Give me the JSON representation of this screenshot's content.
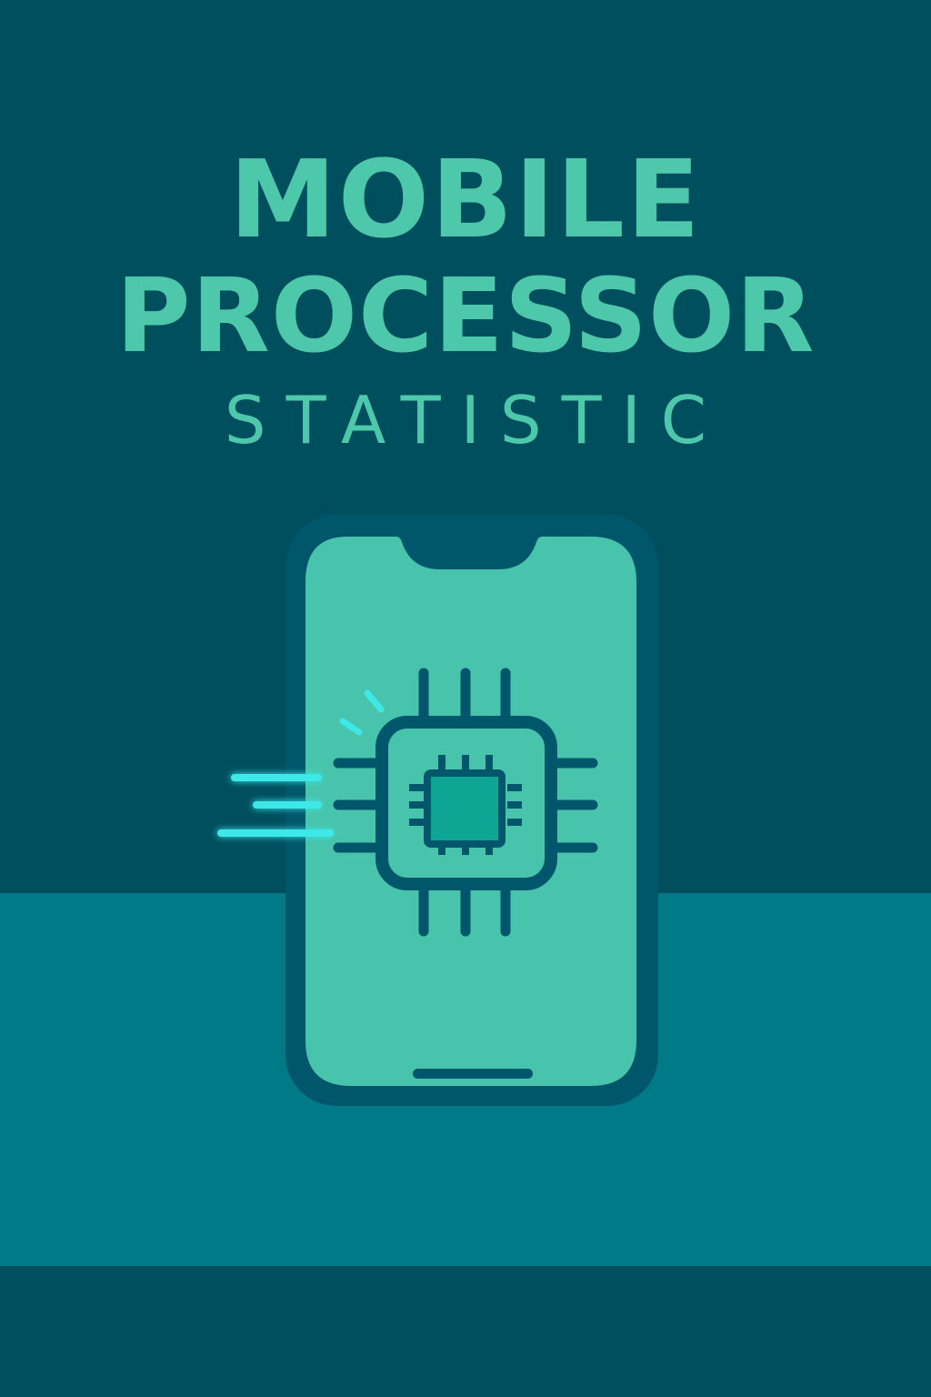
{
  "poster": {
    "title_line_1": "MOBILE",
    "title_line_2": "PROCESSOR",
    "subtitle": "STATISTIC"
  },
  "colors": {
    "background_dark": "#004f5f",
    "floor": "#007a86",
    "phone_frame": "#00566a",
    "phone_screen": "#47c4ab",
    "chip_core": "#0ea595",
    "title_text": "#4ec8aa",
    "speed_lines": "#3ee8e8"
  },
  "icons": {
    "phone": "smartphone-icon",
    "chip": "processor-chip-icon",
    "motion": "speed-lines-icon"
  }
}
